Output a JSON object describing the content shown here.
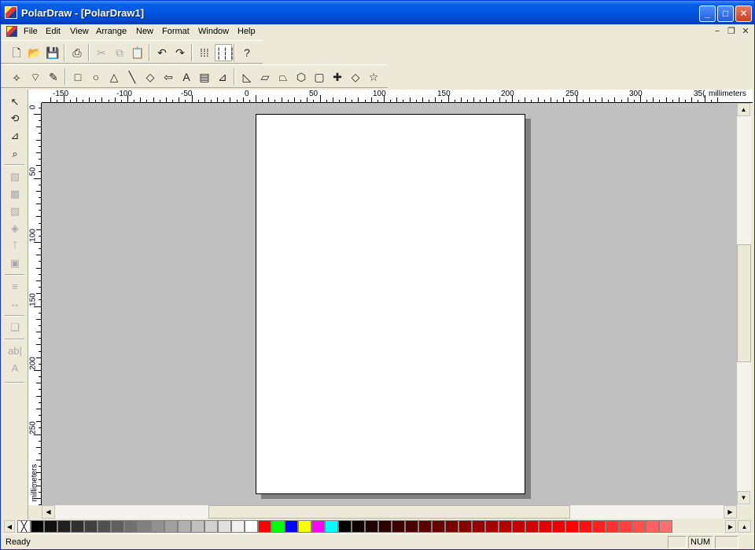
{
  "window": {
    "title": "PolarDraw - [PolarDraw1]"
  },
  "caption_buttons": [
    {
      "name": "minimize",
      "glyph": "_"
    },
    {
      "name": "maximize",
      "glyph": "□"
    },
    {
      "name": "close",
      "glyph": "✕"
    }
  ],
  "menubar": {
    "items": [
      "File",
      "Edit",
      "View",
      "Arrange",
      "New",
      "Format",
      "Window",
      "Help"
    ],
    "mdi_controls": [
      "−",
      "❐",
      "✕"
    ]
  },
  "toolbar_standard": [
    {
      "name": "new-file-icon",
      "glyph": "🗋",
      "enabled": true
    },
    {
      "name": "open-folder-icon",
      "glyph": "📂",
      "enabled": true
    },
    {
      "name": "save-disk-icon",
      "glyph": "💾",
      "enabled": true
    },
    {
      "name": "print-icon",
      "glyph": "⎙",
      "enabled": true
    },
    {
      "name": "cut-icon",
      "glyph": "✂",
      "enabled": false
    },
    {
      "name": "copy-icon",
      "glyph": "⧉",
      "enabled": false
    },
    {
      "name": "paste-icon",
      "glyph": "📋",
      "enabled": true
    },
    {
      "name": "undo-icon",
      "glyph": "↶",
      "enabled": true
    },
    {
      "name": "redo-icon",
      "glyph": "↷",
      "enabled": true
    },
    {
      "name": "grid-dots-icon",
      "glyph": "⁞⁞⁞",
      "enabled": true
    },
    {
      "name": "grid-lines-icon",
      "glyph": "┆┆┆",
      "enabled": true
    },
    {
      "name": "help-icon",
      "glyph": "?",
      "enabled": true
    }
  ],
  "toolbar_shapes": [
    {
      "name": "pen-icon",
      "glyph": "⟡"
    },
    {
      "name": "bezier-icon",
      "glyph": "⌔"
    },
    {
      "name": "freehand-icon",
      "glyph": "✎"
    },
    {
      "name": "rectangle-icon",
      "glyph": "□"
    },
    {
      "name": "ellipse-icon",
      "glyph": "○"
    },
    {
      "name": "triangle-icon",
      "glyph": "△"
    },
    {
      "name": "line-icon",
      "glyph": "╲"
    },
    {
      "name": "diamond-icon",
      "glyph": "◇"
    },
    {
      "name": "arrow-left-icon",
      "glyph": "⇦"
    },
    {
      "name": "text-icon",
      "glyph": "A"
    },
    {
      "name": "text-frame-icon",
      "glyph": "▤"
    },
    {
      "name": "dimension-icon",
      "glyph": "⊿"
    },
    {
      "name": "right-triangle-icon",
      "glyph": "◺"
    },
    {
      "name": "parallelogram-icon",
      "glyph": "▱"
    },
    {
      "name": "trapezoid-icon",
      "glyph": "⏢"
    },
    {
      "name": "hexagon-icon",
      "glyph": "⬡"
    },
    {
      "name": "rounded-rect-icon",
      "glyph": "▢"
    },
    {
      "name": "cross-icon",
      "glyph": "✚"
    },
    {
      "name": "rhombus-icon",
      "glyph": "◇"
    },
    {
      "name": "star-icon",
      "glyph": "☆"
    }
  ],
  "toolbox": [
    {
      "name": "select-arrow-icon",
      "glyph": "↖",
      "enabled": true
    },
    {
      "name": "rotate-icon",
      "glyph": "⟲",
      "enabled": true
    },
    {
      "name": "node-edit-icon",
      "glyph": "⊿",
      "enabled": true
    },
    {
      "name": "zoom-icon",
      "glyph": "⌕",
      "enabled": true
    },
    {
      "name": "fill-pattern-icon",
      "glyph": "▨",
      "enabled": false
    },
    {
      "name": "fill-checker-icon",
      "glyph": "▩",
      "enabled": false
    },
    {
      "name": "fill-hatch-icon",
      "glyph": "▧",
      "enabled": false
    },
    {
      "name": "paint-bucket-icon",
      "glyph": "◈",
      "enabled": false
    },
    {
      "name": "brush-icon",
      "glyph": "⍑",
      "enabled": false
    },
    {
      "name": "image-frame-icon",
      "glyph": "▣",
      "enabled": false
    },
    {
      "name": "line-style-icon",
      "glyph": "≡",
      "enabled": false
    },
    {
      "name": "arrow-ends-icon",
      "glyph": "↔",
      "enabled": false
    },
    {
      "name": "shadow-icon",
      "glyph": "❏",
      "enabled": false
    },
    {
      "name": "text-abc-icon",
      "glyph": "ab|",
      "enabled": false
    },
    {
      "name": "font-icon",
      "glyph": "A",
      "enabled": false
    }
  ],
  "ruler": {
    "unit": "millimeters",
    "h_labels": [
      "-150",
      "-100",
      "-50",
      "0",
      "50",
      "100",
      "150",
      "200",
      "250",
      "300",
      "35("
    ],
    "v_labels": [
      "0",
      "50",
      "100",
      "150",
      "200",
      "250"
    ]
  },
  "palette": {
    "none_glyph": "╳",
    "colors": [
      "#000000",
      "#101010",
      "#202020",
      "#303030",
      "#404040",
      "#505050",
      "#606060",
      "#707070",
      "#808080",
      "#909090",
      "#a0a0a0",
      "#b0b0b0",
      "#c0c0c0",
      "#d0d0d0",
      "#e0e0e0",
      "#f0f0f0",
      "#ffffff",
      "#ff0000",
      "#00ff00",
      "#0000ff",
      "#ffff00",
      "#ff00ff",
      "#00ffff",
      "#000000",
      "#0f0000",
      "#1e0000",
      "#2d0000",
      "#3c0000",
      "#4b0000",
      "#5a0000",
      "#690000",
      "#780000",
      "#870000",
      "#960000",
      "#a50000",
      "#b40000",
      "#c30000",
      "#d20000",
      "#e10000",
      "#f00000",
      "#ff0000",
      "#ff1010",
      "#ff2020",
      "#ff3030",
      "#ff4040",
      "#ff5050",
      "#ff6060",
      "#ff7070"
    ]
  },
  "status": {
    "message": "Ready",
    "num": "NUM"
  }
}
